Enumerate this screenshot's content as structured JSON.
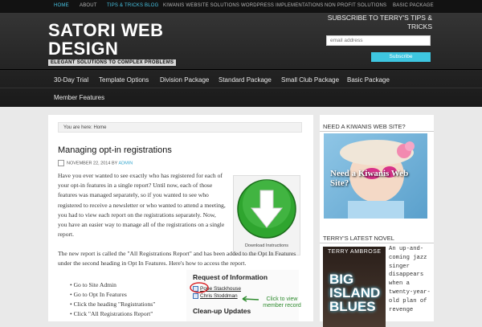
{
  "topnav": {
    "home": "HOME",
    "about": "ABOUT",
    "tips": "TIPS & TRICKS BLOG",
    "kiwanis": "KIWANIS WEBSITE SOLUTIONS",
    "wordpress": "WORDPRESS IMPLEMENTATIONS",
    "nonprofit": "NON PROFIT SOLUTIONS",
    "basic": "BASIC PACKAGE"
  },
  "site": {
    "title_line1": "SATORI WEB",
    "title_line2": "DESIGN",
    "tagline": "ELEGANT SOLUTIONS TO COMPLEX PROBLEMS"
  },
  "subscribe": {
    "title": "SUBSCRIBE TO TERRY'S TIPS & TRICKS",
    "placeholder": "email address",
    "button": "Subscribe"
  },
  "mainnav": {
    "trial": "30-Day Trial",
    "template": "Template Options",
    "division": "Division Package",
    "standard": "Standard Package",
    "smallclub": "Small Club Package",
    "basic": "Basic Package",
    "member": "Member Features"
  },
  "breadcrumb": "You are here: Home",
  "post": {
    "title": "Managing opt-in registrations",
    "date": "NOVEMBER 22, 2014",
    "by": "BY",
    "author": "ADMIN",
    "paragraph1": "Have you ever wanted to see exactly who has registered for each of your opt-in features in a single report? Until now, each of those features was managed separately, so if you wanted to see who registered to receive a newsletter or who wanted to attend a meeting, you had to view each report on the registrations separately. Now, you have an easier way to manage all of the registrations on a single report.",
    "paragraph2": "The new report is called the \"All Registrations Report\" and has been added to the Opt In Features under the second heading in Opt In Features. Here's how to access the report.",
    "steps": [
      "Go to Site Admin",
      "Go to Opt In Features",
      "Click the heading \"Registrations\"",
      "Click \"All Registrations Report\""
    ],
    "figure_caption": "Download Instructions"
  },
  "request_box": {
    "title": "Request of Information",
    "name1": "Pope Stackhouse",
    "name2": "Chris Stoddman",
    "note": "Click to view member record",
    "cleanup": "Clean-up Updates"
  },
  "sidebar": {
    "kiwanis_title": "NEED A KIWANIS WEB SITE?",
    "kiwanis_image_text": "Need a Kiwanis Web Site?",
    "novel_title": "TERRY'S LATEST NOVEL",
    "book_author": "TERRY AMBROSE",
    "book_title_1": "BIG",
    "book_title_2": "ISLAND",
    "book_title_3": "BLUES",
    "novel_desc": "An up-and-coming jazz singer disappears when a twenty-year-old plan of revenge"
  },
  "colors": {
    "accent": "#3ec6e0",
    "topnav_active": "#48c6e6",
    "download_green": "#2fa52f",
    "annotation_green": "#2e8b2e",
    "circle_red": "#d9262a"
  }
}
